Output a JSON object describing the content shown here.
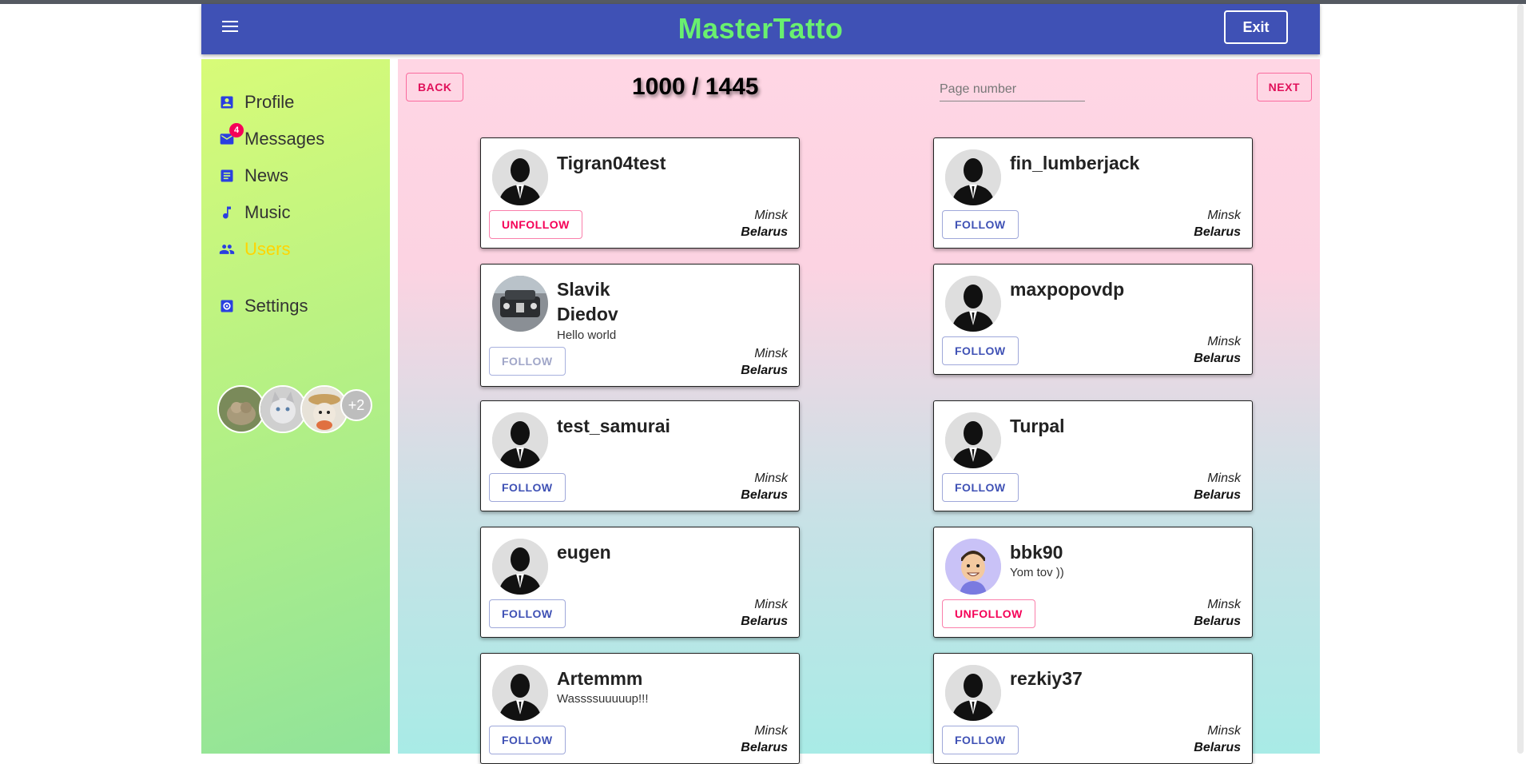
{
  "appbar": {
    "brand": "MasterTatto",
    "exit_label": "Exit",
    "menu_icon": "hamburger-menu-icon"
  },
  "sidebar": {
    "items": [
      {
        "label": "Profile",
        "icon": "account-box-icon"
      },
      {
        "label": "Messages",
        "icon": "mail-icon",
        "badge": "4"
      },
      {
        "label": "News",
        "icon": "news-icon"
      },
      {
        "label": "Music",
        "icon": "music-note-icon"
      },
      {
        "label": "Users",
        "icon": "people-icon",
        "active": true
      },
      {
        "label": "Settings",
        "icon": "settings-icon"
      }
    ],
    "friends_more": "+2"
  },
  "pager": {
    "back_label": "BACK",
    "next_label": "NEXT",
    "count": "1000 / 1445",
    "placeholder": "Page number"
  },
  "users": [
    {
      "name": "Tigran04test",
      "status": "",
      "city": "Minsk",
      "country": "Belarus",
      "button": "UNFOLLOW",
      "avatar": "default-silhouette"
    },
    {
      "name": "fin_lumberjack",
      "status": "",
      "city": "Minsk",
      "country": "Belarus",
      "button": "FOLLOW",
      "avatar": "default-silhouette"
    },
    {
      "name": "Slavik Diedov",
      "status": "Hello world",
      "city": "Minsk",
      "country": "Belarus",
      "button": "FOLLOW",
      "button_disabled": true,
      "avatar": "car-photo"
    },
    {
      "name": "maxpopovdp",
      "status": "",
      "city": "Minsk",
      "country": "Belarus",
      "button": "FOLLOW",
      "avatar": "default-silhouette"
    },
    {
      "name": "test_samurai",
      "status": "",
      "city": "Minsk",
      "country": "Belarus",
      "button": "FOLLOW",
      "avatar": "default-silhouette"
    },
    {
      "name": "Turpal",
      "status": "",
      "city": "Minsk",
      "country": "Belarus",
      "button": "FOLLOW",
      "avatar": "default-silhouette"
    },
    {
      "name": "eugen",
      "status": "",
      "city": "Minsk",
      "country": "Belarus",
      "button": "FOLLOW",
      "avatar": "default-silhouette"
    },
    {
      "name": "bbk90",
      "status": "Yom tov ))",
      "city": "Minsk",
      "country": "Belarus",
      "button": "UNFOLLOW",
      "avatar": "cartoon-man"
    },
    {
      "name": "Artemmm",
      "status": "Wassssuuuuup!!!",
      "city": "Minsk",
      "country": "Belarus",
      "button": "FOLLOW",
      "avatar": "default-silhouette"
    },
    {
      "name": "rezkiy37",
      "status": "",
      "city": "Minsk",
      "country": "Belarus",
      "button": "FOLLOW",
      "avatar": "default-silhouette"
    }
  ],
  "colors": {
    "appbar": "#3f51b5",
    "brand": "#69f06f",
    "active_nav": "#ffd400",
    "secondary": "#f50057"
  }
}
